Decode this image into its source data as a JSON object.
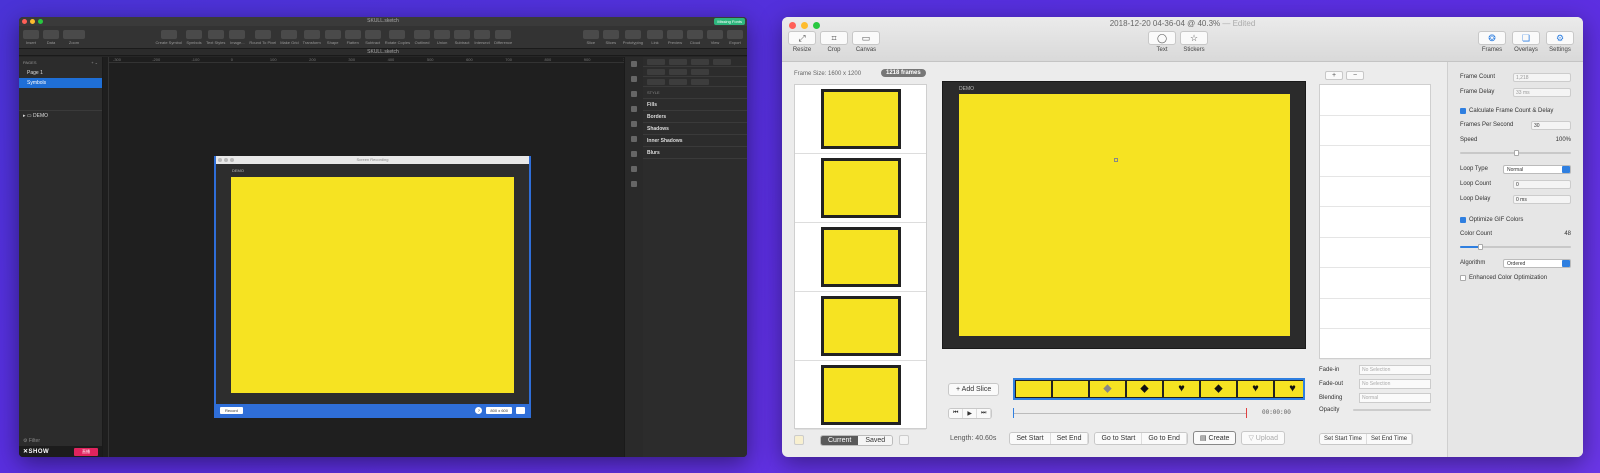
{
  "sketch": {
    "window_title": "SKULL.sketch",
    "badge": "Missing Fonts",
    "toolbar_left": [
      "Insert",
      "Data",
      "Zoom"
    ],
    "zoom_value": "61%",
    "toolbar_mid": [
      "Create Symbol",
      "Symbols",
      "Text Styles",
      "Image...",
      "Round To Pixel",
      "Make Grid",
      "Transform",
      "Shape",
      "Flatten",
      "Subtract",
      "Rotate Copies",
      "Outlined",
      "Union",
      "Subtract",
      "Intersect",
      "Difference"
    ],
    "toolbar_right": [
      "Slice",
      "Slices",
      "Prototyping",
      "Link",
      "Preview",
      "Cloud",
      "View",
      "Export"
    ],
    "doc_tab": "SKULL.sketch",
    "pages_header": "PAGES",
    "pages": [
      "Page 1",
      "Symbols"
    ],
    "layer": "DEMO",
    "filter": "Filter",
    "footer_logo": "SHOW",
    "footer_live": "直播",
    "ruler_marks": [
      "-300",
      "-200",
      "-100",
      "0",
      "100",
      "200",
      "300",
      "400",
      "500",
      "600",
      "700",
      "800",
      "900",
      "1,000"
    ],
    "recorder": {
      "title": "Screen Recording",
      "demo": "DEMO",
      "record": "Record",
      "help": "?",
      "size": "800 x 600"
    },
    "inspector": {
      "style_label": "STYLE",
      "sections": [
        "Fills",
        "Borders",
        "Shadows",
        "Inner Shadows",
        "Blurs"
      ]
    }
  },
  "gifski": {
    "title": "2018-12-20 04-36-04 @ 40.3%",
    "edited": "— Edited",
    "tools_left": [
      {
        "label": "Resize",
        "icon": "resize-icon",
        "glyph": "⤢"
      },
      {
        "label": "Crop",
        "icon": "crop-icon",
        "glyph": "⌗"
      },
      {
        "label": "Canvas",
        "icon": "canvas-icon",
        "glyph": "▭"
      }
    ],
    "tools_mid": [
      {
        "label": "Text",
        "icon": "text-bubble-icon",
        "glyph": "◯"
      },
      {
        "label": "Stickers",
        "icon": "star-icon",
        "glyph": "☆"
      }
    ],
    "tools_right": [
      {
        "label": "Frames",
        "icon": "frames-icon",
        "glyph": "❂"
      },
      {
        "label": "Overlays",
        "icon": "overlays-icon",
        "glyph": "❏"
      },
      {
        "label": "Settings",
        "icon": "gear-icon",
        "glyph": "⚙"
      }
    ],
    "frame_size": "Frame Size: 1600 x 1200",
    "frame_count": "1218 frames",
    "canvas_demo": "DEMO",
    "add_slice": "+ Add Slice",
    "strip_glyphs": [
      "",
      "",
      "◆",
      "◆",
      "♥",
      "◆",
      "♥",
      "♥"
    ],
    "playback": [
      "⏮",
      "▶",
      "⏭"
    ],
    "timecode": "00:00:00",
    "tabs": {
      "current": "Current",
      "saved": "Saved"
    },
    "length": "Length: 40.60s",
    "buttons": {
      "set_start": "Set Start",
      "set_end": "Set End",
      "go_start": "Go to Start",
      "go_end": "Go to End",
      "create": "Create",
      "upload": "Upload"
    },
    "slices_pm": [
      "+",
      "−"
    ],
    "fade": {
      "fade_in": "Fade-in",
      "fade_out": "Fade-out",
      "no_sel": "No Selection",
      "blending": "Blending",
      "blending_val": "Normal",
      "opacity": "Opacity"
    },
    "set_times": {
      "start": "Set Start Time",
      "end": "Set End Time"
    },
    "settings": {
      "frame_count": "Frame Count",
      "frame_count_val": "1,218",
      "frame_delay": "Frame Delay",
      "frame_delay_val": "33 ms",
      "calc": "Calculate Frame Count & Delay",
      "fps": "Frames Per Second",
      "fps_val": "30",
      "speed": "Speed",
      "speed_val": "100%",
      "speed_level": 0.5,
      "loop_type": "Loop Type",
      "loop_type_val": "Normal",
      "loop_count": "Loop Count",
      "loop_count_val": "0",
      "loop_delay": "Loop Delay",
      "loop_delay_val": "0 ms",
      "optimize": "Optimize GIF Colors",
      "color_count": "Color Count",
      "color_count_val": "48",
      "color_level": 0.18,
      "algorithm": "Algorithm",
      "algorithm_val": "Ordered",
      "enhanced": "Enhanced Color Optimization"
    }
  }
}
